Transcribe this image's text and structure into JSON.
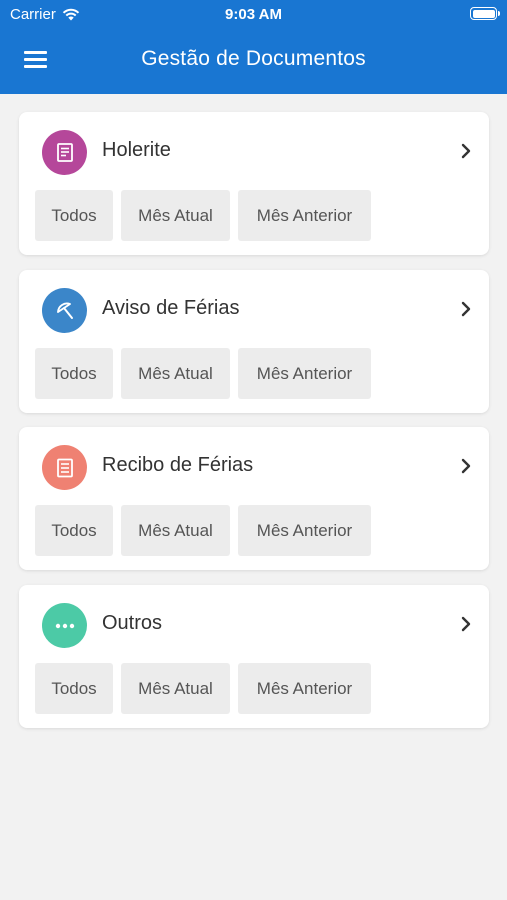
{
  "status_bar": {
    "carrier": "Carrier",
    "time": "9:03 AM"
  },
  "header": {
    "title": "Gestão de Documentos",
    "menu_icon": "hamburger-menu-icon"
  },
  "categories": [
    {
      "label": "Holerite",
      "icon": "document-icon",
      "color": "#b5479a",
      "buttons": [
        "Todos",
        "Mês Atual",
        "Mês Anterior"
      ]
    },
    {
      "label": "Aviso de Férias",
      "icon": "umbrella-icon",
      "color": "#3b86c9",
      "buttons": [
        "Todos",
        "Mês Atual",
        "Mês Anterior"
      ]
    },
    {
      "label": "Recibo de Férias",
      "icon": "receipt-icon",
      "color": "#ef8172",
      "buttons": [
        "Todos",
        "Mês Atual",
        "Mês Anterior"
      ]
    },
    {
      "label": "Outros",
      "icon": "more-dots-icon",
      "color": "#4ccaa6",
      "buttons": [
        "Todos",
        "Mês Atual",
        "Mês Anterior"
      ]
    }
  ],
  "colors": {
    "header_bg": "#1976d2",
    "page_bg": "#f2f2f2",
    "button_bg": "#ececec"
  }
}
